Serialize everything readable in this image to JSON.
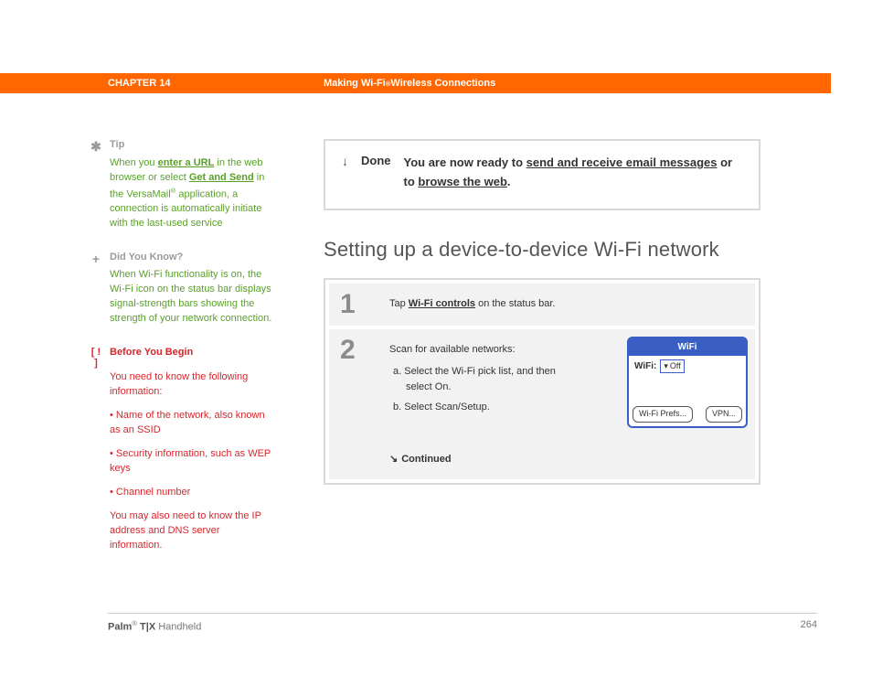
{
  "header": {
    "chapter": "CHAPTER 14",
    "title_pre": "Making Wi-Fi",
    "title_post": " Wireless Connections"
  },
  "sidebar": {
    "tip": {
      "title": "Tip",
      "t1": "When you ",
      "link1": "enter a URL",
      "t2": " in the web browser or select ",
      "link2": "Get and Send",
      "t3": " in the VersaMail",
      "t4": " application, a connection is automatically initiate with the last-used service"
    },
    "dyk": {
      "title": "Did You Know?",
      "body": "When Wi-Fi functionality is on, the Wi-Fi icon on the status bar displays signal-strength bars showing the strength of your network connection."
    },
    "byb": {
      "prefix": "[ ! ]",
      "title": "Before You Begin",
      "intro": "You need to know the following information:",
      "b1": "Name of the network, also known as an SSID",
      "b2": "Security information, such as WEP keys",
      "b3": "Channel number",
      "outro": "You may also need to know the IP address and DNS server information."
    }
  },
  "done": {
    "label": "Done",
    "pre": "You are now ready to ",
    "link1": "send and receive email messages",
    "mid": " or to ",
    "link2": "browse the web",
    "post": "."
  },
  "section_title": "Setting up a device-to-device Wi-Fi network",
  "steps": {
    "s1": {
      "num": "1",
      "pre": "Tap ",
      "link": "Wi-Fi controls",
      "post": " on the status bar."
    },
    "s2": {
      "num": "2",
      "intro": "Scan for available networks:",
      "a": "a.  Select the Wi-Fi pick list, and then select On.",
      "b": "b.  Select Scan/Setup.",
      "continued": "Continued"
    }
  },
  "wifi": {
    "title": "WiFi",
    "label": "WiFi:",
    "value": "Off",
    "btn1": "Wi-Fi Prefs...",
    "btn2": "VPN..."
  },
  "footer": {
    "brand_pre": "Palm",
    "brand_mid": " T|X",
    "brand_post": " Handheld",
    "page": "264"
  }
}
